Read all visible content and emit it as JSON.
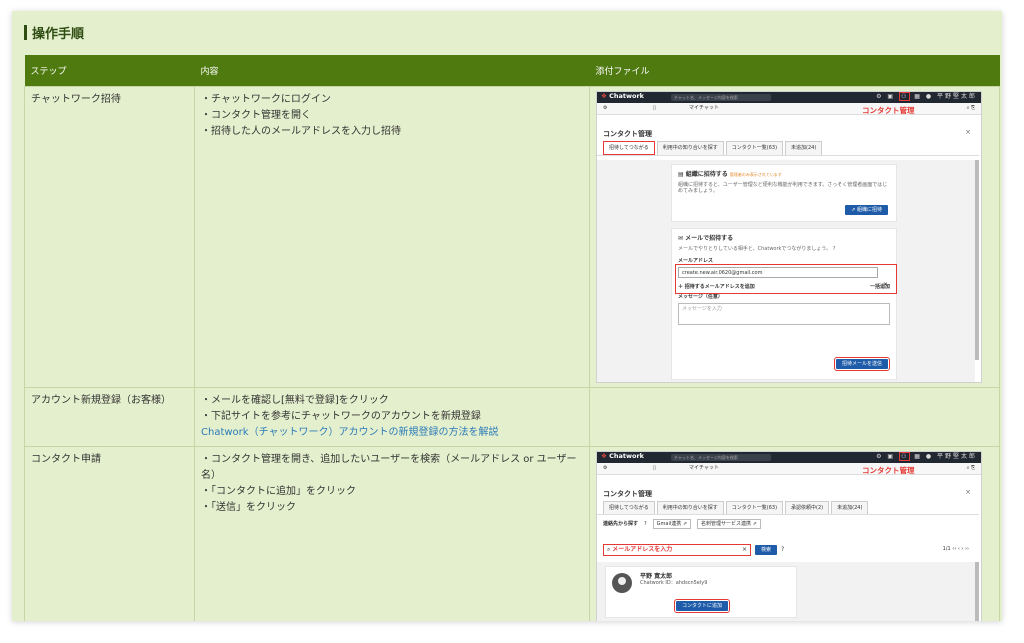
{
  "heading": "操作手順",
  "table": {
    "headers": [
      "ステップ",
      "内容",
      "添付ファイル"
    ],
    "rows": [
      {
        "step": "チャットワーク招待",
        "lines": [
          "・チャットワークにログイン",
          "・コンタクト管理を開く",
          "・招待した人のメールアドレスを入力し招待"
        ]
      },
      {
        "step": "アカウント新規登録（お客様）",
        "lines": [
          "・メールを確認し[無料で登録]をクリック",
          "・下記サイトを参考にチャットワークのアカウントを新規登録"
        ],
        "link": "Chatwork（チャットワーク）アカウントの新規登録の方法を解説"
      },
      {
        "step": "コンタクト申請",
        "lines": [
          "・コンタクト管理を開き、追加したいユーザーを検索（メールアドレス or ユーザー名）",
          "・「コンタクトに追加」をクリック",
          "・「送信」をクリック"
        ]
      }
    ]
  },
  "shot1": {
    "logo": "Chatwork",
    "search_placeholder": "チャット名、メッセージ内容を検索",
    "user": "平野堅太郎",
    "room": "マイチャット",
    "annotation": "コンタクト管理",
    "modal_title": "コンタクト管理",
    "close": "×",
    "tabs": [
      "招待してつながる",
      "利用中の知り合いを探す",
      "コンタクト一覧(63)",
      "未追加(24)"
    ],
    "org_title": "組織に招待する",
    "org_note": "管理者のみ表示されています",
    "org_desc": "組織に招待すると、ユーザー管理など便利な機能が利用できます。さっそく管理者画面ではじめてみましょう。",
    "org_btn": "組織に招待",
    "mail_title": "メールで招待する",
    "mail_desc": "メールでやりとりしている相手と、Chatworkでつながりましょう。",
    "mail_label": "メールアドレス",
    "mail_value": "create.new.air.0620@gmail.com",
    "add_mail": "招待するメールアドレスを追加",
    "bulk_add": "一括追加",
    "msg_label": "メッセージ（任意）",
    "msg_placeholder": "メッセージを入力",
    "send_btn": "招待メールを送信"
  },
  "shot3": {
    "logo": "Chatwork",
    "search_placeholder": "チャット名、メッセージ内容を検索",
    "user": "平野堅太郎",
    "room": "マイチャット",
    "annotation": "コンタクト管理",
    "modal_title": "コンタクト管理",
    "close": "×",
    "tabs": [
      "招待してつながる",
      "利用中の知り合いを探す",
      "コンタクト一覧(63)",
      "承認依頼中(2)",
      "未追加(24)"
    ],
    "find_label": "連絡先から探す",
    "gmail_btn": "Gmail連携",
    "meishi_btn": "名刺管理サービス連携",
    "search_hint": "メールアドレスを入力",
    "search_btn": "検索",
    "pager": "1/1",
    "result_name": "平野 寛太郎",
    "result_id": "Chatwork ID：ahdscn5ely9",
    "add_btn": "コンタクトに追加"
  }
}
